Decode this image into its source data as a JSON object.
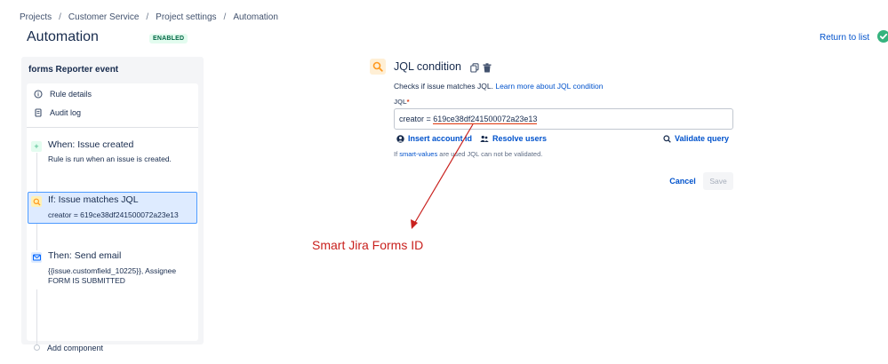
{
  "breadcrumb": [
    "Projects",
    "Customer Service",
    "Project settings",
    "Automation"
  ],
  "page": {
    "title": "Automation",
    "status": "ENABLED",
    "return_link": "Return to list"
  },
  "rule": {
    "name": "forms Reporter event",
    "menu": [
      {
        "label": "Rule details",
        "icon": "info-icon"
      },
      {
        "label": "Audit log",
        "icon": "document-icon"
      }
    ],
    "components": [
      {
        "title": "When: Issue created",
        "desc": [
          "Rule is run when an issue is created."
        ],
        "icon": "plus-icon",
        "color": "#36b37e"
      },
      {
        "title": "If: Issue matches JQL",
        "desc": [
          "creator = 619ce38df241500072a23e13"
        ],
        "icon": "search-icon",
        "color": "#ff991f"
      },
      {
        "title": "Then: Send email",
        "desc": [
          "{{issue.customfield_10225}}, Assignee",
          "FORM IS SUBMITTED"
        ],
        "icon": "mail-icon",
        "color": "#0065ff"
      }
    ],
    "add_component": "Add component"
  },
  "condition": {
    "title": "JQL condition",
    "desc_prefix": "Checks if issue matches JQL.",
    "learn_more": "Learn more about JQL condition",
    "jql_label": "JQL",
    "required_mark": "*",
    "jql_prefix": "creator = ",
    "jql_id": "619ce38df241500072a23e13",
    "insert_account": "Insert account id",
    "resolve_users": "Resolve users",
    "validate_query": "Validate query",
    "hint_prefix": "If ",
    "hint_link": "smart-values",
    "hint_suffix": " are used JQL can not be validated.",
    "cancel": "Cancel",
    "save": "Save"
  },
  "annotation": {
    "text": "Smart Jira Forms ID",
    "color": "#c9211e"
  }
}
